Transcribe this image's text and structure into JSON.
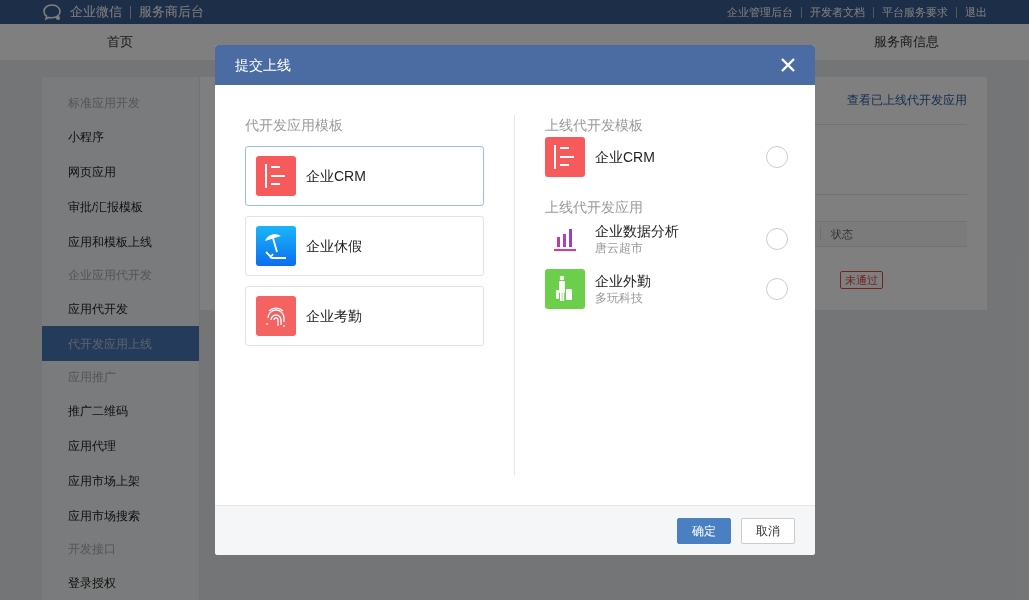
{
  "top_bar": {
    "logo_text": "企业微信",
    "subtitle": "服务商后台",
    "links": [
      "企业管理后台",
      "开发者文档",
      "平台服务要求",
      "退出"
    ]
  },
  "nav": {
    "first": "首页",
    "last": "服务商信息"
  },
  "sidebar": [
    {
      "title": "标准应用开发",
      "items": [
        {
          "label": "小程序",
          "selected": false
        },
        {
          "label": "网页应用",
          "selected": false
        },
        {
          "label": "审批/汇报模板",
          "selected": false
        },
        {
          "label": "应用和模板上线",
          "selected": false
        }
      ]
    },
    {
      "title": "企业应用代开发",
      "items": [
        {
          "label": "应用代开发",
          "selected": false
        },
        {
          "label": "代开发应用上线",
          "selected": true
        }
      ]
    },
    {
      "title": "应用推广",
      "items": [
        {
          "label": "推广二维码",
          "selected": false
        },
        {
          "label": "应用代理",
          "selected": false
        },
        {
          "label": "应用市场上架",
          "selected": false
        },
        {
          "label": "应用市场搜索",
          "selected": false
        }
      ]
    },
    {
      "title": "开发接口",
      "items": [
        {
          "label": "登录授权",
          "selected": false
        }
      ]
    }
  ],
  "main": {
    "link": "查看已上线代开发应用",
    "table_column": "状态",
    "status_badge": "未通过"
  },
  "dialog": {
    "title": "提交上线",
    "left": {
      "title": "代开发应用模板",
      "templates": [
        {
          "name": "企业CRM",
          "kind": "crm",
          "selected": true
        },
        {
          "name": "企业休假",
          "kind": "vacation",
          "selected": false
        },
        {
          "name": "企业考勤",
          "kind": "fingerprint",
          "selected": false
        }
      ]
    },
    "right": [
      {
        "title": "上线代开发模板",
        "items": [
          {
            "name": "企业CRM",
            "kind": "crm",
            "checked": false
          }
        ]
      },
      {
        "title": "上线代开发应用",
        "items": [
          {
            "name": "企业数据分析",
            "subtitle": "唐云超市",
            "kind": "chart",
            "checked": false
          },
          {
            "name": "企业外勤",
            "subtitle": "多玩科技",
            "kind": "traveler",
            "checked": false
          }
        ]
      }
    ],
    "buttons": [
      {
        "label": "确定",
        "kind": "primary"
      },
      {
        "label": "取消",
        "kind": "default"
      }
    ]
  }
}
